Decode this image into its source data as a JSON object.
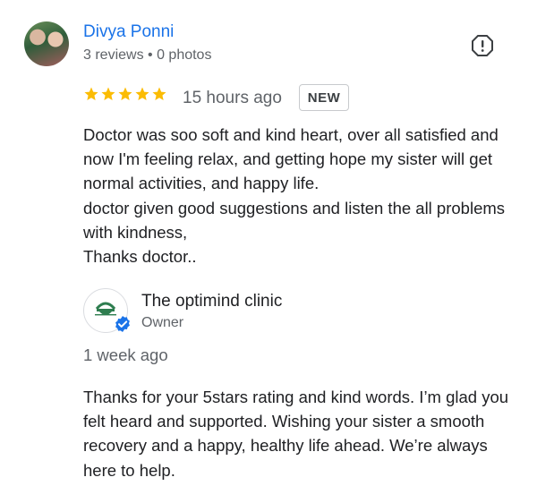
{
  "reviewer": {
    "name": "Divya Ponni",
    "meta": "3 reviews • 0 photos"
  },
  "review": {
    "rating": 5,
    "time": "15 hours ago",
    "badge": "NEW",
    "text": "Doctor was soo soft and kind heart, over all satisfied and now I'm feeling relax, and getting hope my sister will get normal activities, and happy life.\ndoctor given good suggestions and listen the all problems with kindness,\nThanks doctor.."
  },
  "owner_reply": {
    "name": "The optimind clinic",
    "role": "Owner",
    "time": "1 week ago",
    "text": "Thanks for your 5stars rating and kind words. I’m glad you felt heard and supported. Wishing your sister a smooth recovery and a happy, healthy life ahead. We’re always here to help."
  },
  "icons": {
    "report": "report-flag-icon",
    "star": "star-icon",
    "verified": "verified-check-icon"
  },
  "colors": {
    "link": "#1a73e8",
    "star": "#fbbc04",
    "secondary_text": "#5f6368",
    "clinic_green": "#2e7d4f"
  }
}
